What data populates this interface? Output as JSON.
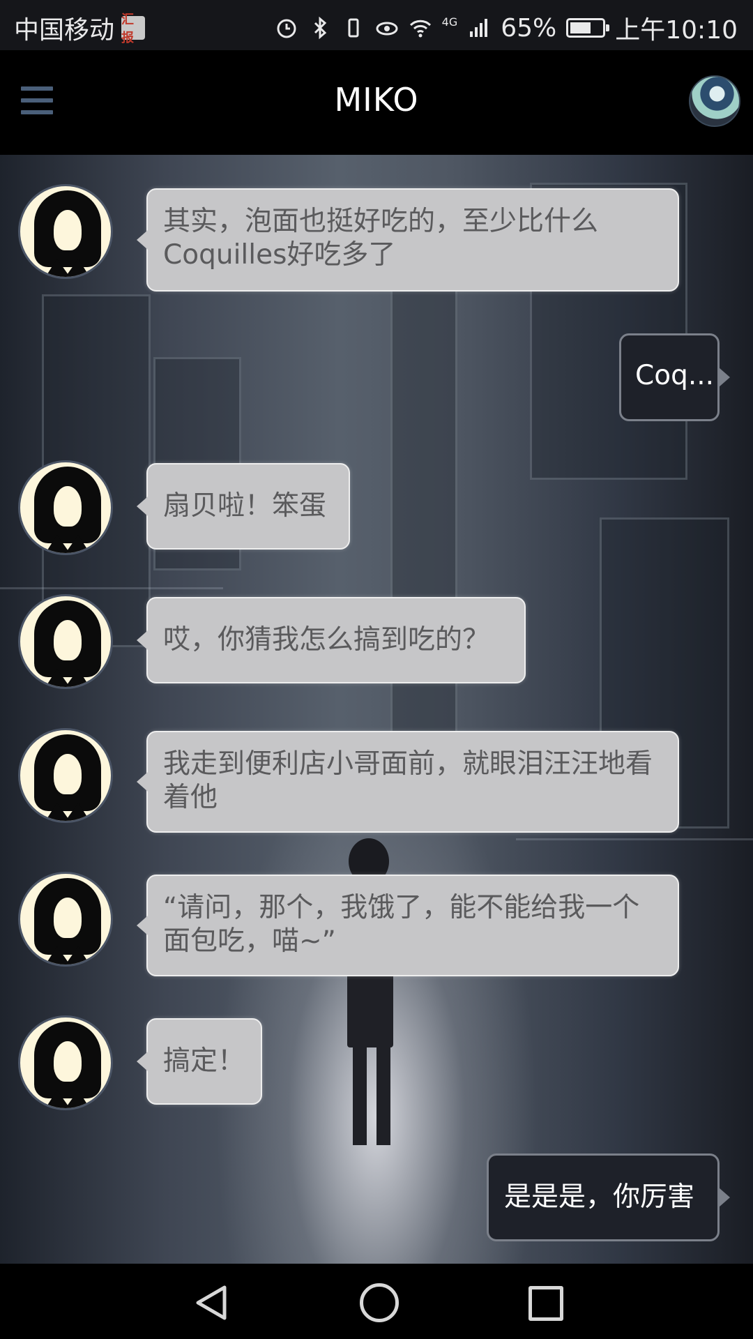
{
  "status_bar": {
    "carrier": "中国移动",
    "carrier_badge": "汇报",
    "network": "4G",
    "battery_percent": "65%",
    "battery_level": 0.65,
    "time": "上午10:10",
    "icons": [
      "alarm-icon",
      "bluetooth-icon",
      "vibrate-icon",
      "eye-comfort-icon",
      "wifi-icon",
      "signal-icon",
      "battery-icon"
    ]
  },
  "app_bar": {
    "title": "MIKO",
    "menu_icon": "hamburger-menu-icon",
    "profile_icon": "profile-avatar"
  },
  "messages": [
    {
      "from": "bot",
      "text": "其实，泡面也挺好吃的，至少比什么Coquilles好吃多了"
    },
    {
      "from": "user",
      "text": "Coq..."
    },
    {
      "from": "bot",
      "text": "扇贝啦！笨蛋"
    },
    {
      "from": "bot",
      "text": "哎，你猜我怎么搞到吃的？"
    },
    {
      "from": "bot",
      "text": "我走到便利店小哥面前，就眼泪汪汪地看着他"
    },
    {
      "from": "bot",
      "text": "“请问，那个，我饿了，能不能给我一个面包吃，喵~”"
    },
    {
      "from": "bot",
      "text": "搞定！"
    },
    {
      "from": "user",
      "text": "是是是，你厉害"
    }
  ],
  "colors": {
    "incoming_bubble": "#c6c6c8",
    "outgoing_bubble": "#1e2129",
    "app_bar": "#000000",
    "menu_icon": "#4a5f7a"
  },
  "nav_bar": {
    "back_icon": "back-triangle-icon",
    "home_icon": "home-circle-icon",
    "recent_icon": "recent-apps-square-icon"
  }
}
